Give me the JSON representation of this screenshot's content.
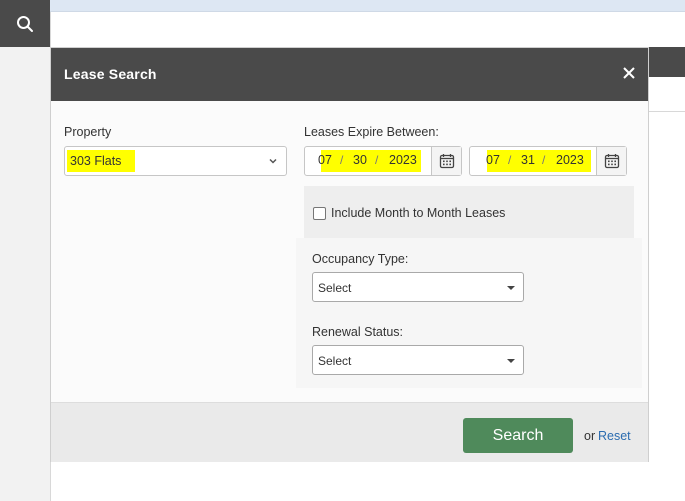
{
  "background": {
    "search_icon": "search-icon",
    "colors": {
      "dark": "#4a4a4a",
      "topbar": "#dde7f3"
    }
  },
  "modal": {
    "title": "Lease Search",
    "close_icon": "close-icon",
    "property": {
      "label": "Property",
      "value": "303 Flats"
    },
    "expire": {
      "label": "Leases Expire Between:",
      "start": {
        "month": "07",
        "day": "30",
        "year": "2023"
      },
      "end": {
        "month": "07",
        "day": "31",
        "year": "2023"
      },
      "separator": "/",
      "calendar_icon": "calendar-icon"
    },
    "month_to_month": {
      "label": "Include Month to Month Leases",
      "checked": false
    },
    "occupancy": {
      "label": "Occupancy Type:",
      "value": "Select"
    },
    "renewal": {
      "label": "Renewal Status:",
      "value": "Select"
    },
    "footer": {
      "search_label": "Search",
      "or_text": "or",
      "reset_label": "Reset"
    },
    "colors": {
      "search_button": "#4f8a5b",
      "highlight": "#ffff00",
      "link": "#2b6cb0"
    }
  }
}
